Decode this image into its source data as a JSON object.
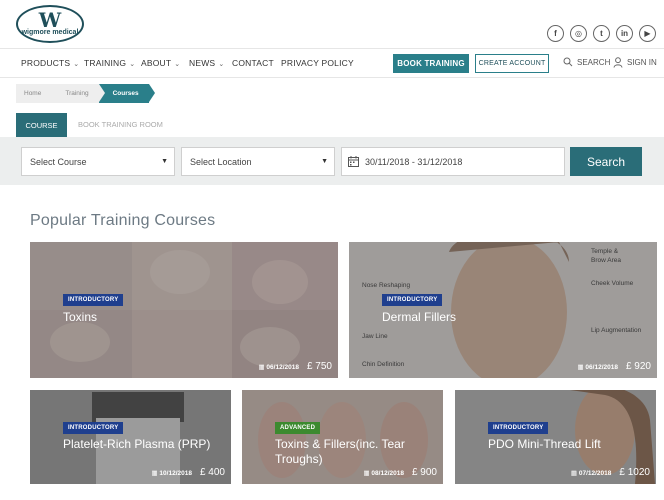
{
  "brand": {
    "logo_letter": "W",
    "logo_text": "wigmore medical"
  },
  "socials": [
    {
      "icon": "facebook-icon",
      "glyph": "f"
    },
    {
      "icon": "instagram-icon",
      "glyph": "◎"
    },
    {
      "icon": "twitter-icon",
      "glyph": "t"
    },
    {
      "icon": "linkedin-icon",
      "glyph": "in"
    },
    {
      "icon": "youtube-icon",
      "glyph": "▶"
    }
  ],
  "nav": {
    "products": "PRODUCTS",
    "training": "TRAINING",
    "about": "ABOUT",
    "news": "NEWS",
    "contact": "CONTACT",
    "privacy": "PRIVACY POLICY",
    "book_training": "BOOK TRAINING",
    "create_account": "CREATE ACCOUNT",
    "search": "SEARCH",
    "sign_in": "SIGN IN"
  },
  "breadcrumb": [
    "Home",
    "Training",
    "Courses"
  ],
  "tabs": {
    "course": "COURSE",
    "book_room": "BOOK TRAINING ROOM"
  },
  "filter": {
    "course": "Select Course",
    "location": "Select Location",
    "date_range": "30/11/2018 - 31/12/2018",
    "search_button": "Search"
  },
  "section_title": "Popular Training Courses",
  "cards": [
    {
      "badge": "INTRODUCTORY",
      "title": "Toxins",
      "date": "06/12/2018",
      "price": "£ 750"
    },
    {
      "badge": "INTRODUCTORY",
      "title": "Dermal Fillers",
      "date": "06/12/2018",
      "price": "£ 920"
    },
    {
      "badge": "INTRODUCTORY",
      "title": "Platelet-Rich Plasma (PRP)",
      "date": "10/12/2018",
      "price": "£ 400"
    },
    {
      "badge": "ADVANCED",
      "title": "Toxins & Fillers(inc. Tear Troughs)",
      "date": "08/12/2018",
      "price": "£ 900"
    },
    {
      "badge": "INTRODUCTORY",
      "title": "PDO Mini-Thread Lift",
      "date": "07/12/2018",
      "price": "£ 1020"
    }
  ],
  "face_labels": [
    "Temple &",
    "Brow Area",
    "Cheek Volume",
    "Lip Augmentation",
    "Nose Reshaping",
    "Jaw Line",
    "Chin Definition"
  ],
  "colors": {
    "teal": "#2a7f8a",
    "dark_teal": "#2a6d78",
    "intro_badge": "#1f3f8e",
    "advanced_badge": "#3c8a2f"
  }
}
